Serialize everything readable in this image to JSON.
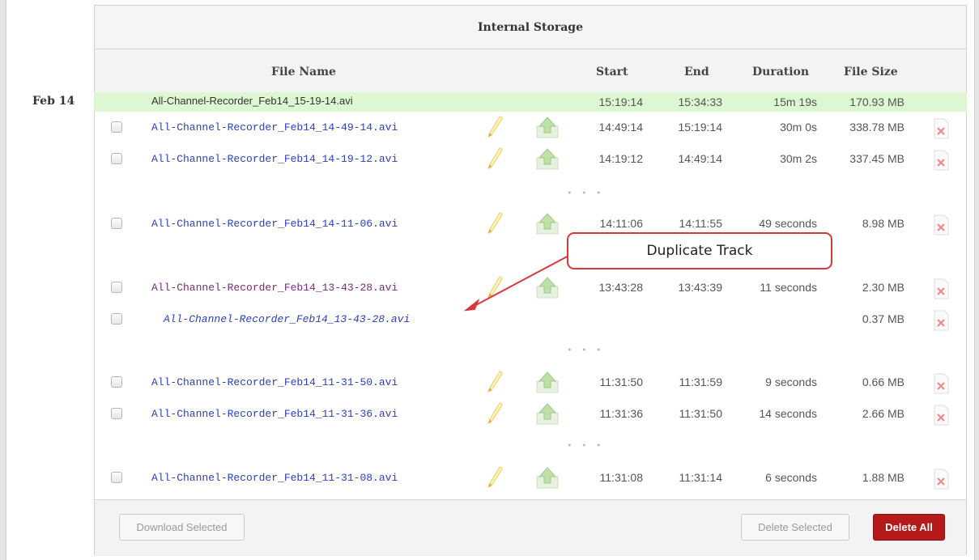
{
  "panel": {
    "title": "Internal Storage",
    "columns": {
      "file_name": "File Name",
      "start": "Start",
      "end": "End",
      "duration": "Duration",
      "file_size": "File Size"
    }
  },
  "date_group": "Feb 14",
  "rows": [
    {
      "name": "All-Channel-Recorder_Feb14_15-19-14.avi",
      "start": "15:19:14",
      "end": "15:34:33",
      "duration": "15m 19s",
      "size": "170.93 MB",
      "state": "recording"
    },
    {
      "name": "All-Channel-Recorder_Feb14_14-49-14.avi",
      "start": "14:49:14",
      "end": "15:19:14",
      "duration": "30m 0s",
      "size": "338.78 MB"
    },
    {
      "name": "All-Channel-Recorder_Feb14_14-19-12.avi",
      "start": "14:19:12",
      "end": "14:49:14",
      "duration": "30m 2s",
      "size": "337.45 MB"
    },
    {
      "name": "All-Channel-Recorder_Feb14_14-11-06.avi",
      "start": "14:11:06",
      "end": "14:11:55",
      "duration": "49 seconds",
      "size": "8.98 MB"
    },
    {
      "name": "All-Channel-Recorder_Feb14_13-43-28.avi",
      "start": "13:43:28",
      "end": "13:43:39",
      "duration": "11 seconds",
      "size": "2.30 MB",
      "state": "visited"
    },
    {
      "name": "All-Channel-Recorder_Feb14_13-43-28.avi",
      "start": "",
      "end": "",
      "duration": "",
      "size": "0.37 MB",
      "state": "duplicate"
    },
    {
      "name": "All-Channel-Recorder_Feb14_11-31-50.avi",
      "start": "11:31:50",
      "end": "11:31:59",
      "duration": "9 seconds",
      "size": "0.66 MB"
    },
    {
      "name": "All-Channel-Recorder_Feb14_11-31-36.avi",
      "start": "11:31:36",
      "end": "11:31:50",
      "duration": "14 seconds",
      "size": "2.66 MB"
    },
    {
      "name": "All-Channel-Recorder_Feb14_11-31-08.avi",
      "start": "11:31:08",
      "end": "11:31:14",
      "duration": "6 seconds",
      "size": "1.88 MB"
    }
  ],
  "ellipsis": "• • •",
  "annotation": {
    "label": "Duplicate Track",
    "color": "#d9383b"
  },
  "footer": {
    "download_label": "Download Selected",
    "delete_selected_label": "Delete Selected",
    "delete_all_label": "Delete All"
  },
  "colors": {
    "link": "#2b3fbf",
    "visited_link": "#7b2a7b",
    "recording_row_bg": "#dcf7d2",
    "danger": "#b51a1a"
  },
  "icons": {
    "edit": "pencil-icon",
    "upload": "upload-arrow-icon",
    "delete": "delete-file-icon"
  }
}
